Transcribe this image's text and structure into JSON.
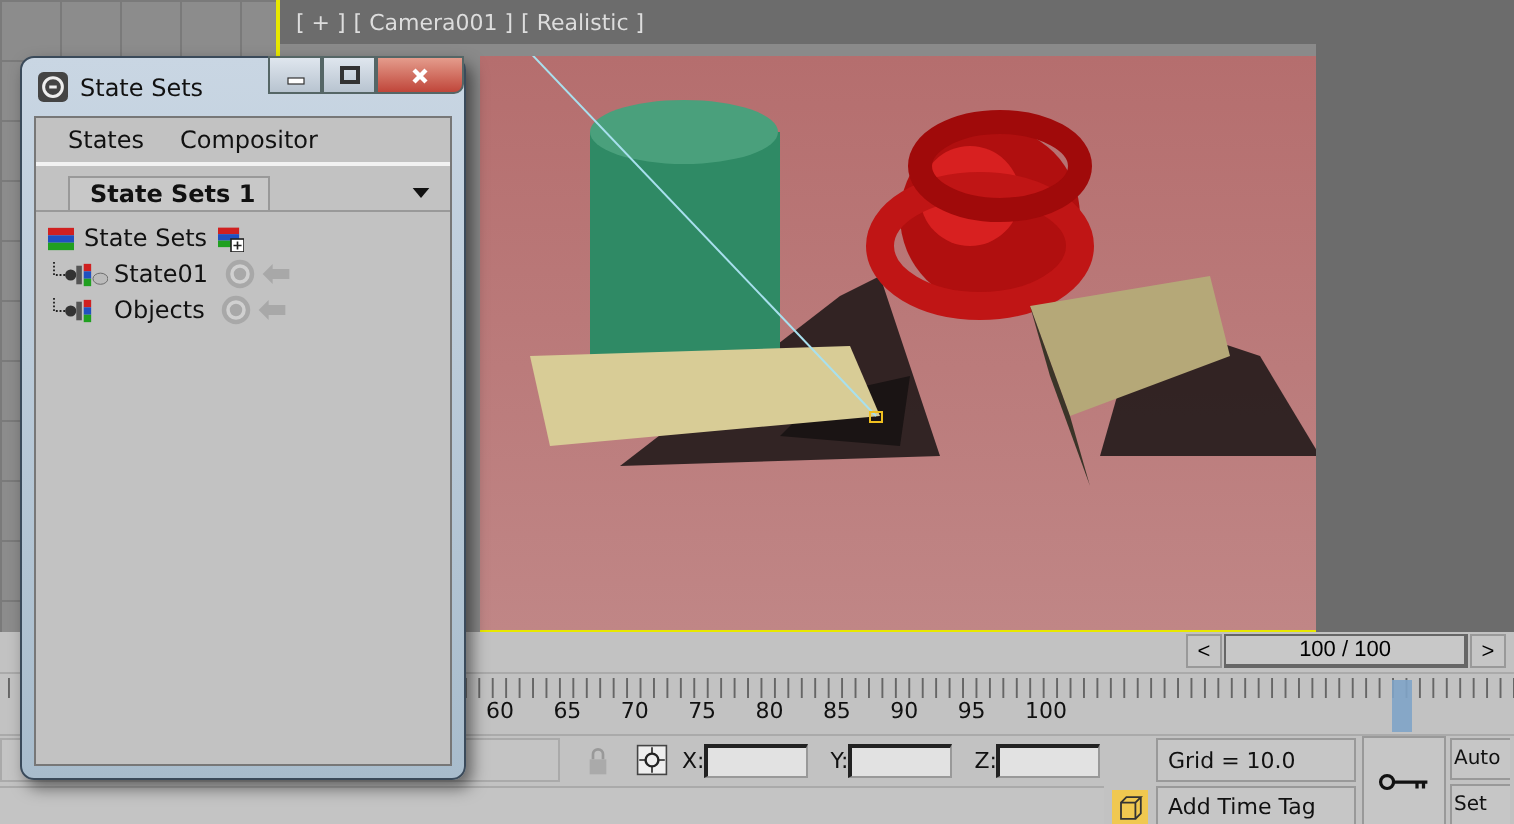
{
  "viewport": {
    "label_parts": [
      "[ + ]",
      "[ Camera001 ]",
      "[ Realistic ]"
    ]
  },
  "window": {
    "title": "State Sets"
  },
  "menu": [
    "States",
    "Compositor"
  ],
  "tabs": [
    {
      "label": "State Sets 1",
      "selected": true
    }
  ],
  "tree": [
    {
      "label": "State Sets",
      "children": [
        {
          "label": "State01"
        },
        {
          "label": "Objects"
        }
      ]
    }
  ],
  "time_slider": {
    "prev": "<",
    "reading": "100 / 100",
    "next": ">",
    "level": 1
  },
  "ruler": {
    "labels": [
      "60",
      "65",
      "70",
      "75",
      "80",
      "85",
      "90",
      "95",
      "100"
    ]
  },
  "coords": [
    {
      "axis": "X:"
    },
    {
      "axis": "Y:"
    },
    {
      "axis": "Z:"
    }
  ],
  "grid_readout": "Grid = 10.0",
  "time_tag": "Add Time Tag",
  "buttons": [
    "Auto",
    "Set"
  ]
}
